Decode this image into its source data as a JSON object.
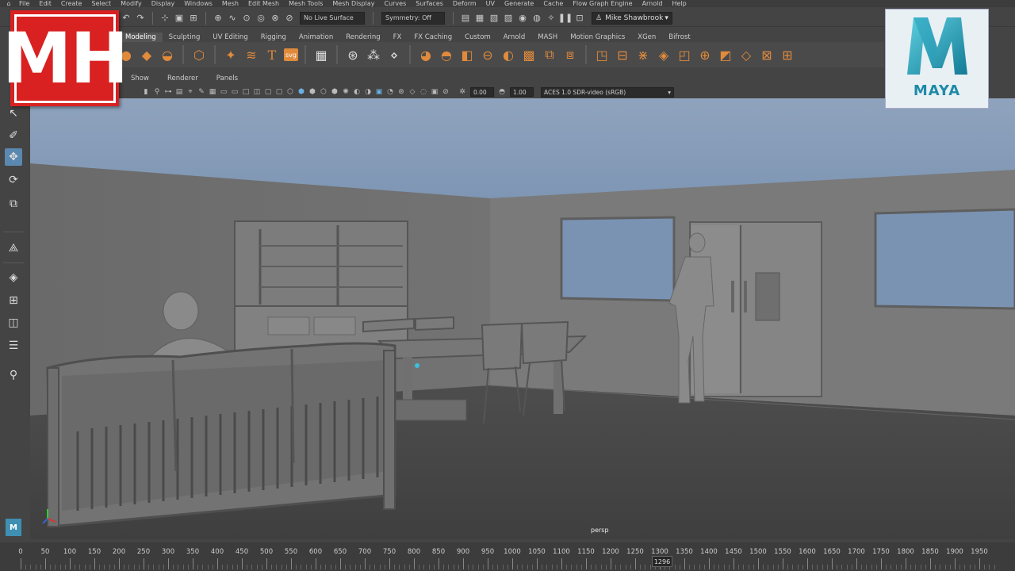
{
  "menu": {
    "items": [
      "File",
      "Edit",
      "Create",
      "Select",
      "Modify",
      "Display",
      "Windows",
      "Mesh",
      "Edit Mesh",
      "Mesh Tools",
      "Mesh Display",
      "Curves",
      "Surfaces",
      "Deform",
      "UV",
      "Generate",
      "Cache",
      "Flow Graph Engine",
      "Arnold",
      "Help"
    ]
  },
  "status_line": {
    "live_surface": "No Live Surface",
    "symmetry": "Symmetry: Off",
    "user": "Mike Shawbrook"
  },
  "shelf": {
    "tabs": [
      "Modeling",
      "Sculpting",
      "UV Editing",
      "Rigging",
      "Animation",
      "Rendering",
      "FX",
      "FX Caching",
      "Custom",
      "Arnold",
      "MASH",
      "Motion Graphics",
      "XGen",
      "Bifrost"
    ],
    "active_tab": "Modeling"
  },
  "panel": {
    "menus": [
      "Show",
      "Renderer",
      "Panels"
    ],
    "exposure": "0.00",
    "gamma": "1.00",
    "color_space": "ACES 1.0 SDR-video (sRGB)",
    "camera": "persp"
  },
  "timeline": {
    "ticks": [
      "0",
      "50",
      "100",
      "150",
      "200",
      "250",
      "300",
      "350",
      "400",
      "450",
      "500",
      "550",
      "600",
      "650",
      "700",
      "750",
      "800",
      "850",
      "900",
      "950",
      "1000",
      "1050",
      "1100",
      "1150",
      "1200",
      "1250",
      "1300",
      "1350",
      "1400",
      "1450",
      "1500",
      "1550",
      "1600",
      "1650",
      "1700",
      "1750",
      "1800",
      "1850",
      "1900",
      "1950"
    ],
    "current_frame": "1296"
  },
  "branding": {
    "channel_logo": "MH",
    "app_logo": "MAYA",
    "mini_logo": "M"
  },
  "colors": {
    "accent_orange": "#e08a3c",
    "selection_blue": "#5a88b0",
    "channel_red": "#d92121",
    "maya_teal": "#1f8aa8"
  }
}
